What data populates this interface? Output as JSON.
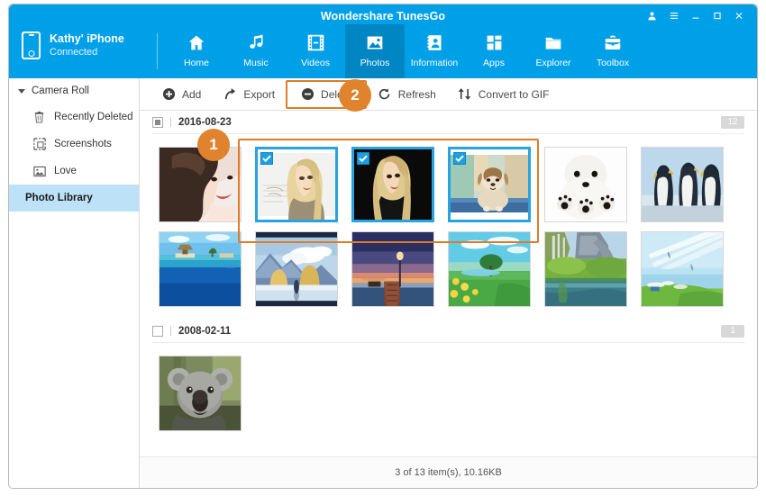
{
  "window": {
    "title": "Wondershare TunesGo",
    "controls": [
      {
        "name": "account-icon",
        "glyph": "👤"
      },
      {
        "name": "menu-icon",
        "glyph": "≡"
      },
      {
        "name": "minimize-icon",
        "glyph": "—"
      },
      {
        "name": "maximize-icon",
        "glyph": "□"
      },
      {
        "name": "close-icon",
        "glyph": "✕"
      }
    ]
  },
  "device": {
    "name": "Kathy' iPhone",
    "status": "Connected",
    "icon": "iphone-icon"
  },
  "nav": {
    "items": [
      {
        "label": "Home",
        "icon": "home-icon",
        "active": false
      },
      {
        "label": "Music",
        "icon": "music-note-icon",
        "active": false
      },
      {
        "label": "Videos",
        "icon": "film-strip-icon",
        "active": false
      },
      {
        "label": "Photos",
        "icon": "picture-icon",
        "active": true
      },
      {
        "label": "Information",
        "icon": "contact-card-icon",
        "active": false
      },
      {
        "label": "Apps",
        "icon": "grid-squares-icon",
        "active": false
      },
      {
        "label": "Explorer",
        "icon": "folder-icon",
        "active": false
      },
      {
        "label": "Toolbox",
        "icon": "briefcase-icon",
        "active": false
      }
    ]
  },
  "sidebar": {
    "group": {
      "label": "Camera Roll",
      "icon": "chevron-down-icon"
    },
    "items": [
      {
        "label": "Recently Deleted",
        "icon": "trash-icon",
        "selected": false
      },
      {
        "label": "Screenshots",
        "icon": "screenshot-icon",
        "selected": false
      },
      {
        "label": "Love",
        "icon": "image-icon",
        "selected": false
      },
      {
        "label": "Photo Library",
        "icon": "",
        "selected": true
      }
    ]
  },
  "toolbar": {
    "buttons": [
      {
        "label": "Add",
        "icon": "plus-circle-icon",
        "highlighted": false
      },
      {
        "label": "Export",
        "icon": "export-arrow-icon",
        "highlighted": false
      },
      {
        "label": "Delete",
        "icon": "minus-circle-icon",
        "highlighted": true
      },
      {
        "label": "Refresh",
        "icon": "refresh-icon",
        "highlighted": false
      },
      {
        "label": "Convert to GIF",
        "icon": "convert-arrows-icon",
        "highlighted": false
      }
    ]
  },
  "badges": [
    {
      "label": "1",
      "color": "#e0832f"
    },
    {
      "label": "2",
      "color": "#e0832f"
    }
  ],
  "groups": [
    {
      "date": "2016-08-23",
      "count": "12",
      "checkbox_state": "partial",
      "photos": [
        {
          "name": "portrait-brunette-woman",
          "selected": false
        },
        {
          "name": "blonde-woman-sketch",
          "selected": true
        },
        {
          "name": "blonde-woman-dark-background",
          "selected": true
        },
        {
          "name": "shih-tzu-puppy",
          "selected": true
        },
        {
          "name": "white-puppy-paws",
          "selected": false
        },
        {
          "name": "penguins-group",
          "selected": false
        },
        {
          "name": "tropical-beach-hut",
          "selected": false
        },
        {
          "name": "anime-lake-mountain",
          "selected": false
        },
        {
          "name": "sunset-pier-lamp",
          "selected": false
        },
        {
          "name": "meadow-tree-flowers",
          "selected": false
        },
        {
          "name": "waterfall-cliff-green",
          "selected": false
        },
        {
          "name": "sunbeam-lake-shore",
          "selected": false
        }
      ]
    },
    {
      "date": "2008-02-11",
      "count": "1",
      "checkbox_state": "empty",
      "photos": [
        {
          "name": "koala-bear",
          "selected": false
        }
      ]
    }
  ],
  "statusbar": {
    "text": "3 of 13 item(s), 10.16KB"
  },
  "colors": {
    "brand_blue": "#00a0e9",
    "nav_active": "#0086c3",
    "selection_blue": "#29a3e0",
    "badge_orange": "#e0832f",
    "sidebar_selected": "#bde2f7"
  }
}
